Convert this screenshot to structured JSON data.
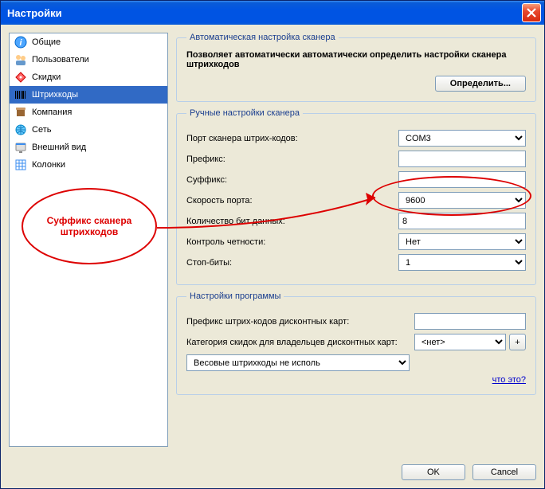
{
  "window": {
    "title": "Настройки"
  },
  "sidebar": {
    "items": [
      {
        "label": "Общие",
        "icon": "info-icon"
      },
      {
        "label": "Пользователи",
        "icon": "users-icon"
      },
      {
        "label": "Скидки",
        "icon": "discount-icon"
      },
      {
        "label": "Штрихкоды",
        "icon": "barcode-icon",
        "selected": true
      },
      {
        "label": "Компания",
        "icon": "company-icon"
      },
      {
        "label": "Сеть",
        "icon": "network-icon"
      },
      {
        "label": "Внешний вид",
        "icon": "appearance-icon"
      },
      {
        "label": "Колонки",
        "icon": "columns-icon"
      }
    ]
  },
  "auto": {
    "legend": "Автоматическая настройка сканера",
    "desc": "Позволяет автоматически автоматически определить настройки сканера штрихкодов",
    "button": "Определить..."
  },
  "manual": {
    "legend": "Ручные настройки сканера",
    "port_label": "Порт сканера штрих-кодов:",
    "port_value": "COM3",
    "prefix_label": "Префикс:",
    "prefix_value": "",
    "suffix_label": "Суффикс:",
    "suffix_value": "",
    "speed_label": "Скорость порта:",
    "speed_value": "9600",
    "bits_label": "Количество бит данных:",
    "bits_value": "8",
    "parity_label": "Контроль четности:",
    "parity_value": "Нет",
    "stop_label": "Стоп-биты:",
    "stop_value": "1"
  },
  "program": {
    "legend": "Настройки программы",
    "discount_prefix_label": "Префикс штрих-кодов дисконтных карт:",
    "discount_prefix_value": "",
    "discount_cat_label": "Категория скидок для владельцев дисконтных карт:",
    "discount_cat_value": "<нет>",
    "weight_value": "Весовые штрихкоды не исполь",
    "help_link": "что это?"
  },
  "footer": {
    "ok": "OK",
    "cancel": "Cancel"
  },
  "annotation": {
    "text": "Суффикс сканера штрихкодов"
  }
}
